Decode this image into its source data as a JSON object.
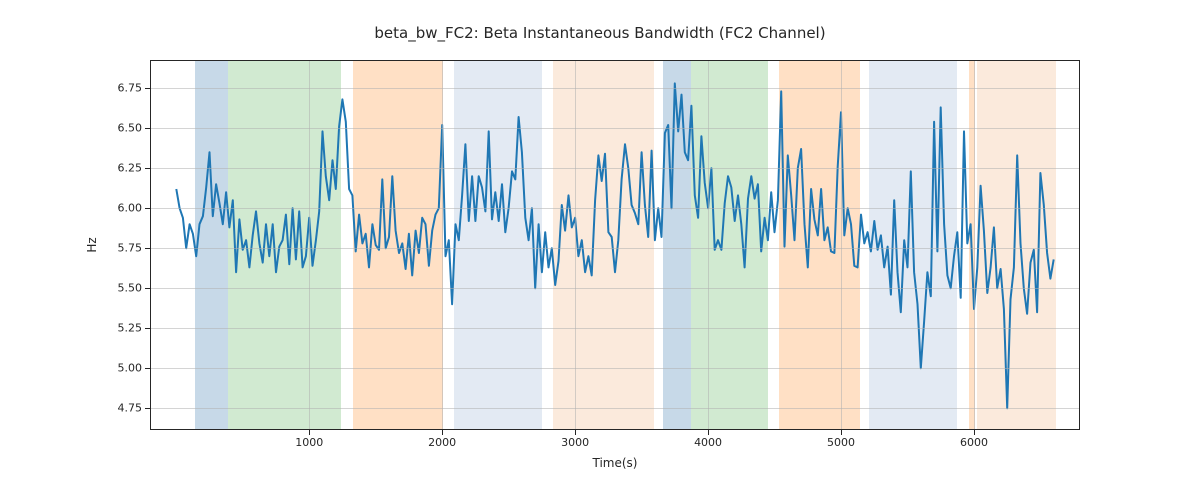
{
  "chart_data": {
    "type": "line",
    "title": "beta_bw_FC2: Beta Instantaneous Bandwidth (FC2 Channel)",
    "xlabel": "Time(s)",
    "ylabel": "Hz",
    "xlim": [
      -190,
      6790
    ],
    "ylim": [
      4.62,
      6.92
    ],
    "xticks": [
      1000,
      2000,
      3000,
      4000,
      5000,
      6000
    ],
    "yticks": [
      4.75,
      5.0,
      5.25,
      5.5,
      5.75,
      6.0,
      6.25,
      6.5,
      6.75
    ],
    "regions": [
      {
        "x0": 140,
        "x1": 390,
        "color": "steelblue"
      },
      {
        "x0": 390,
        "x1": 1240,
        "color": "green"
      },
      {
        "x0": 1330,
        "x1": 2010,
        "color": "orange"
      },
      {
        "x0": 2090,
        "x1": 2750,
        "color": "lavender"
      },
      {
        "x0": 2830,
        "x1": 3590,
        "color": "peach"
      },
      {
        "x0": 3660,
        "x1": 3870,
        "color": "steelblue"
      },
      {
        "x0": 3870,
        "x1": 4450,
        "color": "green"
      },
      {
        "x0": 4530,
        "x1": 5140,
        "color": "orange"
      },
      {
        "x0": 5210,
        "x1": 5870,
        "color": "lavender"
      },
      {
        "x0": 5960,
        "x1": 6010,
        "color": "orange"
      },
      {
        "x0": 6020,
        "x1": 6620,
        "color": "peach"
      }
    ],
    "x": [
      0,
      25,
      50,
      75,
      100,
      125,
      150,
      175,
      200,
      225,
      250,
      275,
      300,
      325,
      350,
      375,
      400,
      425,
      450,
      475,
      500,
      525,
      550,
      575,
      600,
      625,
      650,
      675,
      700,
      725,
      750,
      775,
      800,
      825,
      850,
      875,
      900,
      925,
      950,
      975,
      1000,
      1025,
      1050,
      1075,
      1100,
      1125,
      1150,
      1175,
      1200,
      1225,
      1250,
      1275,
      1300,
      1325,
      1350,
      1375,
      1400,
      1425,
      1450,
      1475,
      1500,
      1525,
      1550,
      1575,
      1600,
      1625,
      1650,
      1675,
      1700,
      1725,
      1750,
      1775,
      1800,
      1825,
      1850,
      1875,
      1900,
      1925,
      1950,
      1975,
      2000,
      2025,
      2050,
      2075,
      2100,
      2125,
      2150,
      2175,
      2200,
      2225,
      2250,
      2275,
      2300,
      2325,
      2350,
      2375,
      2400,
      2425,
      2450,
      2475,
      2500,
      2525,
      2550,
      2575,
      2600,
      2625,
      2650,
      2675,
      2700,
      2725,
      2750,
      2775,
      2800,
      2825,
      2850,
      2875,
      2900,
      2925,
      2950,
      2975,
      3000,
      3025,
      3050,
      3075,
      3100,
      3125,
      3150,
      3175,
      3200,
      3225,
      3250,
      3275,
      3300,
      3325,
      3350,
      3375,
      3400,
      3425,
      3450,
      3475,
      3500,
      3525,
      3550,
      3575,
      3600,
      3625,
      3650,
      3675,
      3700,
      3725,
      3750,
      3775,
      3800,
      3825,
      3850,
      3875,
      3900,
      3925,
      3950,
      3975,
      4000,
      4025,
      4050,
      4075,
      4100,
      4125,
      4150,
      4175,
      4200,
      4225,
      4250,
      4275,
      4300,
      4325,
      4350,
      4375,
      4400,
      4425,
      4450,
      4475,
      4500,
      4525,
      4550,
      4575,
      4600,
      4625,
      4650,
      4675,
      4700,
      4725,
      4750,
      4775,
      4800,
      4825,
      4850,
      4875,
      4900,
      4925,
      4950,
      4975,
      5000,
      5025,
      5050,
      5075,
      5100,
      5125,
      5150,
      5175,
      5200,
      5225,
      5250,
      5275,
      5300,
      5325,
      5350,
      5375,
      5400,
      5425,
      5450,
      5475,
      5500,
      5525,
      5550,
      5575,
      5600,
      5625,
      5650,
      5675,
      5700,
      5725,
      5750,
      5775,
      5800,
      5825,
      5850,
      5875,
      5900,
      5925,
      5950,
      5975,
      6000,
      6025,
      6050,
      6075,
      6100,
      6125,
      6150,
      6175,
      6200,
      6225,
      6250,
      6275,
      6300,
      6325,
      6350,
      6375,
      6400,
      6425,
      6450,
      6475,
      6500,
      6525,
      6550,
      6575,
      6600
    ],
    "y": [
      6.12,
      6.0,
      5.94,
      5.75,
      5.9,
      5.84,
      5.7,
      5.9,
      5.95,
      6.13,
      6.35,
      5.95,
      6.15,
      6.03,
      5.9,
      6.1,
      5.88,
      6.05,
      5.6,
      5.93,
      5.74,
      5.8,
      5.63,
      5.83,
      5.98,
      5.78,
      5.66,
      5.9,
      5.7,
      5.9,
      5.6,
      5.76,
      5.8,
      5.96,
      5.65,
      6.0,
      5.68,
      5.98,
      5.63,
      5.7,
      5.94,
      5.64,
      5.8,
      5.98,
      6.48,
      6.2,
      6.05,
      6.3,
      6.12,
      6.51,
      6.68,
      6.54,
      6.12,
      6.08,
      5.73,
      5.96,
      5.78,
      5.84,
      5.63,
      5.9,
      5.77,
      5.74,
      6.18,
      5.75,
      5.82,
      6.2,
      5.86,
      5.72,
      5.78,
      5.62,
      5.84,
      5.58,
      5.86,
      5.72,
      5.94,
      5.9,
      5.64,
      5.86,
      5.96,
      6.0,
      6.52,
      5.7,
      5.8,
      5.4,
      5.9,
      5.8,
      6.08,
      6.4,
      5.92,
      6.2,
      5.92,
      6.2,
      6.13,
      5.98,
      6.48,
      5.93,
      6.1,
      5.92,
      6.15,
      5.85,
      6.0,
      6.23,
      6.18,
      6.57,
      6.35,
      5.94,
      5.8,
      6.0,
      5.5,
      5.9,
      5.6,
      5.85,
      5.63,
      5.75,
      5.52,
      5.67,
      6.02,
      5.86,
      6.08,
      5.88,
      5.94,
      5.7,
      5.8,
      5.6,
      5.7,
      5.58,
      6.05,
      6.33,
      6.17,
      6.34,
      5.85,
      5.82,
      5.6,
      5.8,
      6.18,
      6.4,
      6.25,
      6.02,
      5.97,
      5.9,
      6.35,
      6.02,
      5.82,
      6.36,
      5.8,
      6.0,
      5.82,
      6.47,
      6.52,
      6.0,
      6.78,
      6.48,
      6.71,
      6.35,
      6.3,
      6.64,
      6.08,
      5.94,
      6.45,
      6.16,
      6.0,
      6.25,
      5.74,
      5.8,
      5.74,
      6.03,
      6.2,
      6.13,
      5.92,
      6.08,
      5.9,
      5.63,
      6.06,
      6.2,
      6.06,
      6.15,
      5.73,
      5.94,
      5.8,
      6.1,
      5.85,
      6.05,
      6.73,
      5.76,
      6.33,
      6.08,
      5.8,
      6.25,
      6.37,
      5.9,
      5.63,
      6.12,
      5.93,
      5.83,
      6.12,
      5.8,
      5.88,
      5.73,
      5.72,
      6.26,
      6.6,
      5.83,
      6.0,
      5.9,
      5.64,
      5.63,
      5.96,
      5.78,
      5.85,
      5.73,
      5.92,
      5.74,
      5.83,
      5.63,
      5.76,
      5.46,
      6.05,
      5.6,
      5.35,
      5.8,
      5.63,
      6.23,
      5.6,
      5.4,
      5.0,
      5.29,
      5.6,
      5.45,
      6.54,
      5.73,
      6.63,
      5.9,
      5.58,
      5.5,
      5.7,
      5.85,
      5.44,
      6.48,
      5.78,
      5.9,
      5.37,
      5.63,
      6.14,
      5.86,
      5.47,
      5.63,
      5.88,
      5.5,
      5.62,
      5.37,
      4.75,
      5.43,
      5.63,
      6.33,
      5.78,
      5.5,
      5.34,
      5.66,
      5.74,
      5.35,
      6.22,
      6.02,
      5.72,
      5.56,
      5.68
    ]
  }
}
